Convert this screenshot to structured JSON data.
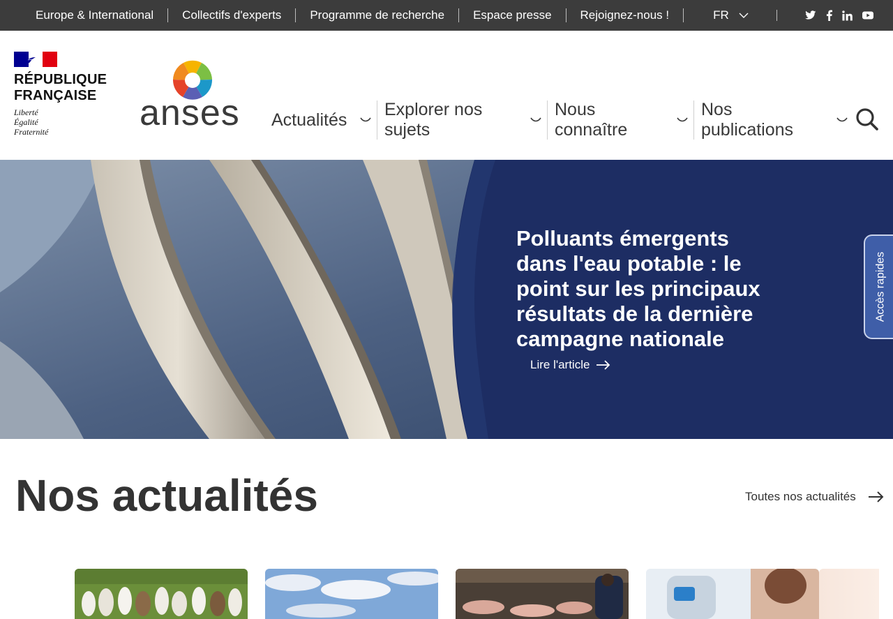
{
  "topbar": {
    "links": [
      "Europe & International",
      "Collectifs d'experts",
      "Programme de recherche",
      "Espace presse",
      "Rejoignez-nous !"
    ],
    "language": "FR",
    "socials": [
      "twitter-icon",
      "facebook-icon",
      "linkedin-icon",
      "youtube-icon"
    ]
  },
  "header": {
    "republique_lines": [
      "RÉPUBLIQUE",
      "FRANÇAISE"
    ],
    "devise_lines": [
      "Liberté",
      "Égalité",
      "Fraternité"
    ],
    "logo_text": "anses",
    "nav": [
      {
        "label": "Actualités"
      },
      {
        "label": "Explorer nos sujets"
      },
      {
        "label": "Nous connaître"
      },
      {
        "label": "Nos publications"
      }
    ]
  },
  "hero": {
    "title": "Polluants émergents dans l'eau potable : le point sur les principaux résultats de la dernière campagne nationale",
    "link_label": "Lire l'article",
    "quick_access": "Accès rapides"
  },
  "news": {
    "title": "Nos actualités",
    "all_link": "Toutes nos actualités"
  },
  "colors": {
    "topbar": "#3c3c3c",
    "hero_panel": "#1d2d63",
    "quick_access": "#3f5ea8",
    "flag_blue": "#000091",
    "flag_red": "#e1000f"
  }
}
